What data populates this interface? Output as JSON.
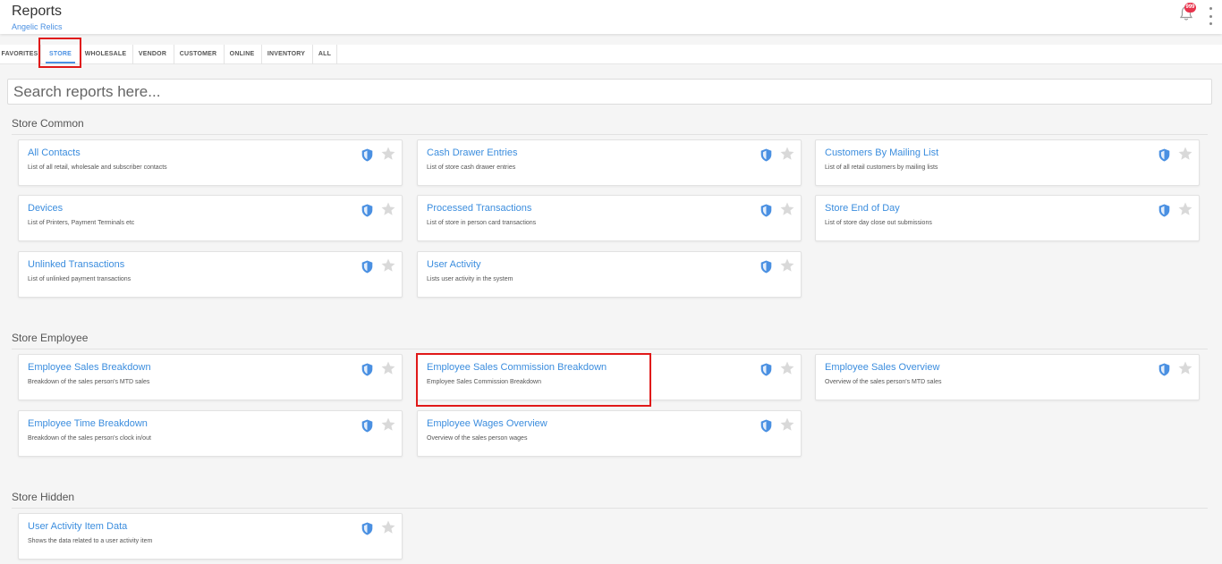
{
  "header": {
    "title": "Reports",
    "subtitle": "Angelic Relics",
    "notification_count": "999",
    "bell_icon": "bell-icon",
    "menu_icon": "kebab-menu-icon"
  },
  "tabs": [
    {
      "label": "FAVORITES"
    },
    {
      "label": "STORE"
    },
    {
      "label": "WHOLESALE"
    },
    {
      "label": "VENDOR"
    },
    {
      "label": "CUSTOMER"
    },
    {
      "label": "ONLINE"
    },
    {
      "label": "INVENTORY"
    },
    {
      "label": "ALL"
    }
  ],
  "active_tab": "STORE",
  "search": {
    "placeholder": "Search reports here...",
    "value": ""
  },
  "sections": [
    {
      "title": "Store Common",
      "reports": [
        {
          "title": "All Contacts",
          "description": "List of all retail, wholesale and subscriber contacts"
        },
        {
          "title": "Cash Drawer Entries",
          "description": "List of store cash drawer entries"
        },
        {
          "title": "Customers By Mailing List",
          "description": "List of all retail customers by mailing lists"
        },
        {
          "title": "Devices",
          "description": "List of Printers, Payment Terminals etc"
        },
        {
          "title": "Processed Transactions",
          "description": "List of store in person card transactions"
        },
        {
          "title": "Store End of Day",
          "description": "List of store day close out submissions"
        },
        {
          "title": "Unlinked Transactions",
          "description": "List of unlinked payment transactions"
        },
        {
          "title": "User Activity",
          "description": "Lists user activity in the system"
        }
      ]
    },
    {
      "title": "Store Employee",
      "reports": [
        {
          "title": "Employee Sales Breakdown",
          "description": "Breakdown of the sales person's MTD sales"
        },
        {
          "title": "Employee Sales Commission Breakdown",
          "description": "Employee Sales Commission Breakdown"
        },
        {
          "title": "Employee Sales Overview",
          "description": "Overview of the sales person's MTD sales"
        },
        {
          "title": "Employee Time Breakdown",
          "description": "Breakdown of the sales person's clock in/out"
        },
        {
          "title": "Employee Wages Overview",
          "description": "Overview of the sales person wages"
        }
      ]
    },
    {
      "title": "Store Hidden",
      "reports": [
        {
          "title": "User Activity Item Data",
          "description": "Shows the data related to a user activity item"
        }
      ]
    }
  ],
  "colors": {
    "accent": "#4a90e2",
    "link": "#3b8dde",
    "highlight": "#e01818",
    "badge": "#e8344d",
    "star": "#d9d9d9"
  },
  "card_icons": [
    "shield-icon",
    "star-icon"
  ]
}
